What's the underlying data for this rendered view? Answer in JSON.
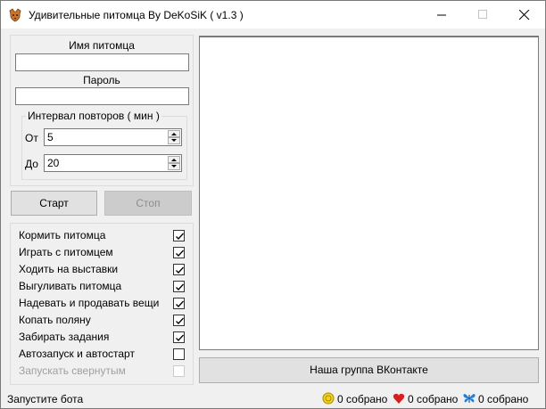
{
  "window": {
    "title": "Удивительные питомца By DeKoSiK ( v1.3 )",
    "icon": "pet-app-icon",
    "controls": [
      "minimize-icon",
      "maximize-icon",
      "close-icon"
    ]
  },
  "login": {
    "pet_name_label": "Имя питомца",
    "pet_name_value": "",
    "password_label": "Пароль",
    "password_value": ""
  },
  "interval": {
    "legend": "Интервал повторов ( мин )",
    "from_label": "От",
    "from_value": "5",
    "to_label": "До",
    "to_value": "20"
  },
  "buttons": {
    "start": "Старт",
    "stop": "Стоп",
    "vk_group": "Наша группа ВКонтакте"
  },
  "options": [
    {
      "label": "Кормить питомца",
      "checked": true,
      "enabled": true
    },
    {
      "label": "Играть с питомцем",
      "checked": true,
      "enabled": true
    },
    {
      "label": "Ходить на выставки",
      "checked": true,
      "enabled": true
    },
    {
      "label": "Выгуливать питомца",
      "checked": true,
      "enabled": true
    },
    {
      "label": "Надевать и продавать вещи",
      "checked": true,
      "enabled": true
    },
    {
      "label": "Копать поляну",
      "checked": true,
      "enabled": true
    },
    {
      "label": "Забирать задания",
      "checked": true,
      "enabled": true
    },
    {
      "label": "Автозапуск и автостарт",
      "checked": false,
      "enabled": true
    },
    {
      "label": "Запускать свернутым",
      "checked": false,
      "enabled": false
    }
  ],
  "log": {
    "content": ""
  },
  "status": {
    "message": "Запустите бота",
    "coins": "0 собрано",
    "hearts": "0 собрано",
    "butterflies": "0 собрано"
  },
  "colors": {
    "window_bg": "#f0f0f0",
    "button_bg": "#e1e1e1",
    "disabled_button_bg": "#cccccc",
    "coin": "#f2d21b",
    "heart": "#d91e1e",
    "butterfly": "#1e7fd9"
  }
}
